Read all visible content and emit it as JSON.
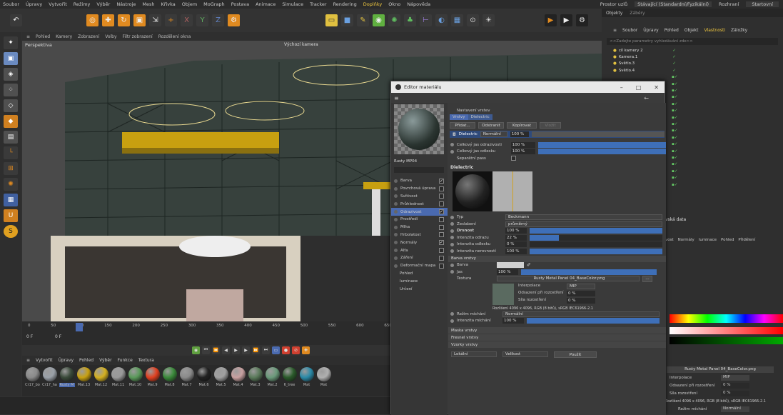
{
  "menu": [
    "Soubor",
    "Úpravy",
    "Vytvořit",
    "Režimy",
    "Výběr",
    "Nástroje",
    "Mesh",
    "Křivka",
    "Objem",
    "MoGraph",
    "Postava",
    "Animace",
    "Simulace",
    "Tracker",
    "Rendering",
    "Doplňky",
    "Okno",
    "Nápověda"
  ],
  "menu_right": {
    "layout_label": "Prostor uzlů",
    "layout_value": "Stávající (Standardní/Fyzikální)",
    "interface_label": "Rozhraní",
    "interface_value": "Startovní"
  },
  "viewport": {
    "menu": [
      "Pohled",
      "Kamery",
      "Zobrazení",
      "Volby",
      "Filtr zobrazení",
      "Rozdělení okna"
    ],
    "name": "Perspektiva",
    "camera": "Výchozí kamera"
  },
  "timeline": {
    "ticks": [
      "0",
      "50",
      "100",
      "150",
      "200",
      "250",
      "300",
      "350",
      "400",
      "450",
      "500",
      "550",
      "600",
      "650"
    ],
    "frame_start": "0 F",
    "frame_current": "0 F"
  },
  "material_menu": [
    "Vytvořit",
    "Úpravy",
    "Pohled",
    "Výběr",
    "Funkce",
    "Textura"
  ],
  "materials": [
    {
      "name": "Cr17_bo",
      "color": "#8a8a8a"
    },
    {
      "name": "Cr17_ha",
      "color": "#9aa0a8"
    },
    {
      "name": "Rusty M",
      "color": "#3a4a3a"
    },
    {
      "name": "Mat.13",
      "color": "#c8a010"
    },
    {
      "name": "Mat.12",
      "color": "#d4b020"
    },
    {
      "name": "Mat.11",
      "color": "#9a9a9a"
    },
    {
      "name": "Mat.10",
      "color": "#5a9a5a"
    },
    {
      "name": "Mat.9",
      "color": "#e04020"
    },
    {
      "name": "Mat.8",
      "color": "#3a8a3a"
    },
    {
      "name": "Mat.7",
      "color": "#8a8a8a"
    },
    {
      "name": "Mat.6",
      "color": "#222222"
    },
    {
      "name": "Mat.5",
      "color": "#a0a0a0"
    },
    {
      "name": "Mat.4",
      "color": "#c8a0a0"
    },
    {
      "name": "Mat.3",
      "color": "#5a7a5a"
    },
    {
      "name": "Mat.2",
      "color": "#6a9a7a"
    },
    {
      "name": "6_tree",
      "color": "#2a5a2a"
    },
    {
      "name": "Mat",
      "color": "#2a8aa8"
    },
    {
      "name": "Mat",
      "color": "#b0b0b0"
    }
  ],
  "right_panel": {
    "tabs": [
      "Objekty",
      "Záběry"
    ],
    "menu": [
      "Soubor",
      "Úpravy",
      "Pohled",
      "Objekt",
      "Vlastnosti",
      "Záložky"
    ],
    "search_placeholder": "<<Zadejte parametry vyhledávání zde>>",
    "objects": [
      "cíl kamery 2",
      "Kamera.1",
      "Světlo.3",
      "Světlo.4"
    ],
    "attr_title": "vská data",
    "attr_tabs": [
      "vost",
      "Normály",
      "luminace",
      "Pohled",
      "Přidělení"
    ],
    "texture_name": "Rusty Metal Panel 04_BaseColor.png",
    "interpolace_label": "Interpolace",
    "interpolace_value": "MIP",
    "odsazeni_label": "Odsazení při rozostření",
    "odsazeni_value": "0 %",
    "sila_label": "Síla rozostření",
    "sila_value": "0 %",
    "resolution": "Rozlišení 4096 x 4096, RGB (8 bitů), sRGB IEC61966-2.1",
    "rezim_label": "Režim míchání",
    "rezim_value": "Normální"
  },
  "editor": {
    "title": "Editor materiálu",
    "material_name": "Rusty MP04",
    "channels": [
      {
        "name": "Barva",
        "checked": true
      },
      {
        "name": "Povrchová úprava",
        "checked": false
      },
      {
        "name": "Svítivost",
        "checked": false
      },
      {
        "name": "Průhlednost",
        "checked": false
      },
      {
        "name": "Odrazivost",
        "checked": true,
        "active": true
      },
      {
        "name": "Prostředí",
        "checked": false
      },
      {
        "name": "Mlha",
        "checked": false
      },
      {
        "name": "Hrbolatost",
        "checked": false
      },
      {
        "name": "Normály",
        "checked": true
      },
      {
        "name": "Alfa",
        "checked": false
      },
      {
        "name": "Záření",
        "checked": false
      },
      {
        "name": "Deformační mapa",
        "checked": false
      }
    ],
    "extra": [
      "Pohled",
      "luminace",
      "Určení"
    ],
    "layers_header": "Nastavení vrstev",
    "layer_tabs": [
      "Vrstvy",
      "Dielectric"
    ],
    "layer_buttons": [
      "Přidat...",
      "Odstranit",
      "Kopírovat",
      "Vložit"
    ],
    "layer_row": {
      "name": "Dielectric",
      "mode": "Normální",
      "value": "100 %"
    },
    "celkovy_odraz_label": "Celkový jas odrazivosti",
    "celkovy_odraz_value": "100 %",
    "celkovy_odlesk_label": "Celkový jas odlesku",
    "celkovy_odlesk_value": "100 %",
    "separatni_label": "Separátní pass",
    "section": "Dielectric",
    "typ_label": "Typ",
    "typ_value": "Beckmann",
    "zeslabeni_label": "Zeslabení",
    "zeslabeni_value": "průměrný",
    "drsnost_label": "Drsnost",
    "drsnost_value": "100 %",
    "drsnost_level": 1.0,
    "intenzita_odrazu_label": "Intenzita odrazu",
    "intenzita_odrazu_value": "22 %",
    "intenzita_odrazu_level": 0.22,
    "intenzita_odlesku_label": "Intenzita odlesku",
    "intenzita_odlesku_value": "0 %",
    "intenzita_odlesku_level": 0.0,
    "intenzita_nerovnosti_label": "Intenzita nerovností",
    "intenzita_nerovnosti_value": "100 %",
    "intenzita_nerovnosti_level": 1.0,
    "barva_vrstvy": "Barva vrstvy",
    "barva_label": "Barva",
    "jas_label": "Jas",
    "jas_value": "100 %",
    "textura_label": "Textura",
    "texture_name": "Rusty Metal Panel 04_BaseColor.png",
    "interpolace_label": "Interpolace",
    "interpolace_value": "MIP",
    "odsazeni_label": "Odsazení při rozostření",
    "odsazeni_value": "0 %",
    "sila_label": "Síla rozostření",
    "sila_value": "0 %",
    "resolution": "Rozlišení 4096 x 4096, RGB (8 bitů), sRGB IEC61966-2.1",
    "rezim_label": "Režim míchání",
    "rezim_value": "Normální",
    "intenzita_michani_label": "Intenzita míchání",
    "intenzita_michani_value": "100 %",
    "sections_bottom": [
      "Maska vrstvy",
      "Fresnel vrstvy",
      "Vzorky vrstvy"
    ],
    "bottom": {
      "left": "Lokální",
      "mid": "Velikost",
      "button": "Použít"
    }
  }
}
